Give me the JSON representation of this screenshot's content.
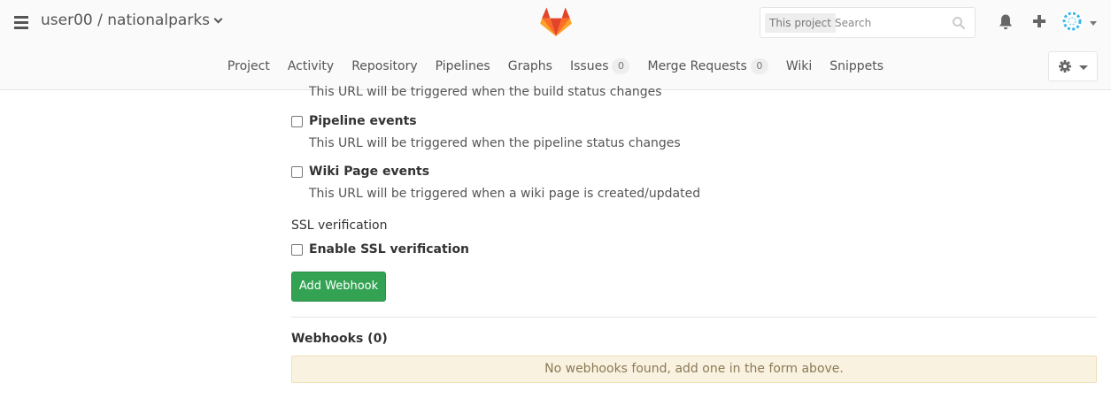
{
  "header": {
    "project_title": "user00 / nationalparks",
    "search": {
      "scope": "This project",
      "placeholder": "Search"
    }
  },
  "nav": {
    "items": [
      {
        "label": "Project"
      },
      {
        "label": "Activity"
      },
      {
        "label": "Repository"
      },
      {
        "label": "Pipelines"
      },
      {
        "label": "Graphs"
      },
      {
        "label": "Issues",
        "count": "0"
      },
      {
        "label": "Merge Requests",
        "count": "0"
      },
      {
        "label": "Wiki"
      },
      {
        "label": "Snippets"
      }
    ]
  },
  "form": {
    "build_help": "This URL will be triggered when the build status changes",
    "pipeline_label": "Pipeline events",
    "pipeline_help": "This URL will be triggered when the pipeline status changes",
    "wiki_label": "Wiki Page events",
    "wiki_help": "This URL will be triggered when a wiki page is created/updated",
    "ssl_section": "SSL verification",
    "ssl_label": "Enable SSL verification",
    "add_button": "Add Webhook"
  },
  "webhooks": {
    "title": "Webhooks (0)",
    "empty_message": "No webhooks found, add one in the form above."
  },
  "colors": {
    "primary_button": "#33a353",
    "alert_bg": "#faf2e1",
    "logo_orange": "#e24329",
    "logo_light": "#fca326"
  }
}
